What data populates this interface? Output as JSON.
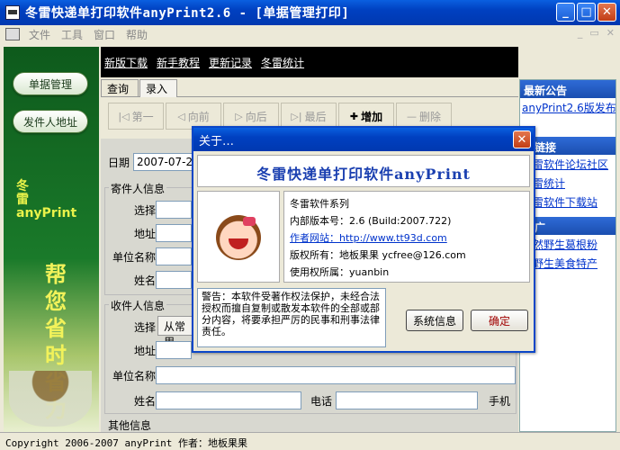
{
  "window": {
    "title": "冬雷快递单打印软件anyPrint2.6 - [单据管理打印]"
  },
  "menu": [
    "文件",
    "工具",
    "窗口",
    "帮助"
  ],
  "sidebar": {
    "buttons": [
      "单据管理",
      "发件人地址"
    ],
    "logo_text": "冬雷anyPrint",
    "slogan": "帮您省时省力"
  },
  "linkbar": [
    "新版下载",
    "新手教程",
    "更新记录",
    "冬雷统计"
  ],
  "tabs": [
    "查询",
    "录入"
  ],
  "toolbar": [
    {
      "label": "第一",
      "icon": "|◁",
      "enabled": false
    },
    {
      "label": "向前",
      "icon": "◁",
      "enabled": false
    },
    {
      "label": "向后",
      "icon": "▷",
      "enabled": false
    },
    {
      "label": "最后",
      "icon": "▷|",
      "enabled": false
    },
    {
      "label": "增加",
      "icon": "✚",
      "enabled": true
    },
    {
      "label": "删除",
      "icon": "—",
      "enabled": false
    }
  ],
  "form": {
    "date_label": "日期",
    "date_value": "2007-07-26",
    "sender_title": "寄件人信息",
    "sender_fields": [
      "选择",
      "地址",
      "单位名称",
      "姓名"
    ],
    "receiver_title": "收件人信息",
    "receiver_select_label": "选择",
    "receiver_select_btn": "从常用",
    "receiver_fields": [
      "地址",
      "单位名称",
      "姓名"
    ],
    "phone_label": "电话",
    "mobile_label": "手机",
    "other_title": "其他信息"
  },
  "right_panel": {
    "sections": [
      {
        "title": "最新公告",
        "links": [
          "anyPrint2.6版发布"
        ]
      },
      {
        "title": "友链接",
        "links": [
          "冬雷软件论坛社区",
          "冬雷统计",
          "冬雷软件下载站"
        ]
      },
      {
        "title": "推广",
        "links": [
          "天然野生葛根粉",
          "陕野生美食特产"
        ]
      }
    ]
  },
  "status": "Copyright 2006-2007 anyPrint 作者：地板果果",
  "dialog": {
    "title": "关于…",
    "banner": "冬雷快递单打印软件anyPrint",
    "series": "冬雷软件系列",
    "version": "内部版本号：2.6 (Build:2007.722)",
    "website_label": "作者网站：",
    "website_url": "http://www.tt93d.com",
    "copyright": "版权所有：地板果果  ycfree@126.com",
    "licensee": "使用权所属：yuanbin",
    "warning": "警告：本软件受著作权法保护，未经合法授权而擅自复制或散发本软件的全部或部分内容，将要承担严厉的民事和刑事法律责任。",
    "sysinfo_btn": "系统信息",
    "ok_btn": "确定"
  }
}
